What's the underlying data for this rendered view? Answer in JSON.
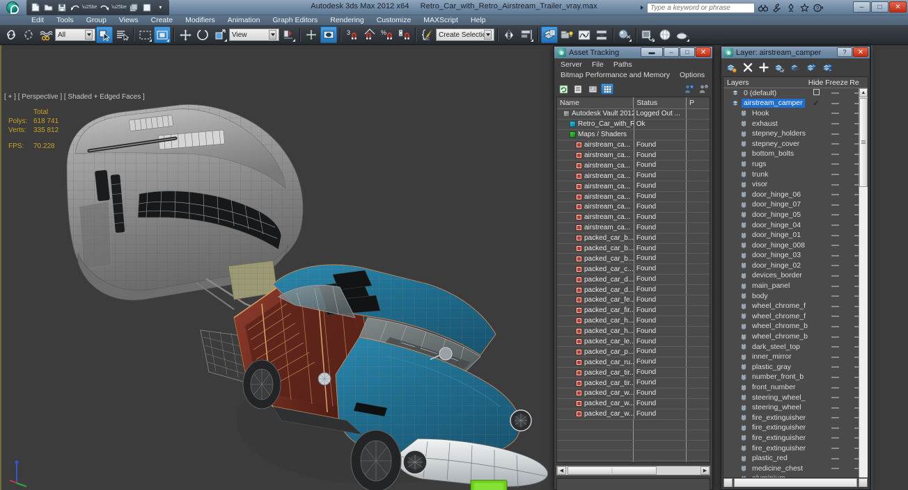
{
  "titlebar": {
    "app_title": "Autodesk 3ds Max  2012 x64",
    "document_title": "Retro_Car_with_Retro_Airstream_Trailer_vray.max",
    "search_placeholder": "Type a keyword or phrase",
    "quick_access": [
      {
        "name": "new-file-icon",
        "glyph": "▢"
      },
      {
        "name": "open-file-icon",
        "glyph": "▷"
      },
      {
        "name": "save-file-icon",
        "glyph": "▣"
      },
      {
        "name": "undo-icon",
        "glyph": "↶"
      },
      {
        "name": "redo-icon",
        "glyph": "↷"
      },
      {
        "name": "set-project-folder-icon",
        "glyph": "❐"
      },
      {
        "name": "render-setup-icon",
        "glyph": "■"
      },
      {
        "name": "customize-qat-icon",
        "glyph": "▾"
      }
    ],
    "title_icons": [
      {
        "name": "search-binoculars-icon",
        "glyph": "ɔɔ"
      },
      {
        "name": "wrench-icon",
        "glyph": "ᴦ"
      },
      {
        "name": "workspaces-icon",
        "glyph": "⥂"
      },
      {
        "name": "favorites-star-icon",
        "glyph": "★"
      },
      {
        "name": "help-icon",
        "glyph": "?"
      }
    ],
    "window_buttons": [
      {
        "name": "minimize-button",
        "glyph": "–"
      },
      {
        "name": "restore-button",
        "glyph": "□"
      },
      {
        "name": "close-button",
        "glyph": "✕"
      }
    ]
  },
  "menubar": {
    "items": [
      "Edit",
      "Tools",
      "Group",
      "Views",
      "Create",
      "Modifiers",
      "Animation",
      "Graph Editors",
      "Rendering",
      "Customize",
      "MAXScript",
      "Help"
    ]
  },
  "toolbar": {
    "selection_filter_value": "All",
    "reference_coordinate_value": "View",
    "named_selection_sets_value": "Create Selection Set",
    "items": [
      {
        "name": "undo-scene-operation-icon",
        "label": "Undo"
      },
      {
        "name": "redo-scene-operation-icon",
        "label": "Redo"
      },
      {
        "name": "select-and-link-icon",
        "label": "Select and Link"
      },
      {
        "name": "unlink-selection-icon",
        "label": "Unlink Selection"
      },
      {
        "name": "bind-to-space-warp-icon",
        "label": "Bind to Space Warp"
      },
      {
        "name": "select-object-icon",
        "label": "Select Object"
      },
      {
        "name": "select-by-name-icon",
        "label": "Select by Name"
      },
      {
        "name": "rectangular-selection-region-icon",
        "label": "Rectangular Selection Region"
      },
      {
        "name": "window-crossing-icon",
        "label": "Window/Crossing"
      },
      {
        "name": "select-and-move-icon",
        "label": "Select and Move"
      },
      {
        "name": "select-and-rotate-icon",
        "label": "Select and Rotate"
      },
      {
        "name": "select-and-scale-icon",
        "label": "Select and Uniform Scale"
      },
      {
        "name": "use-pivot-point-center-icon",
        "label": "Use Pivot Point Center"
      },
      {
        "name": "select-and-manipulate-icon",
        "label": "Select and Manipulate"
      },
      {
        "name": "snaps-toggle-icon",
        "label": "Snaps Toggle"
      },
      {
        "name": "angle-snap-toggle-icon",
        "label": "Angle Snap Toggle"
      },
      {
        "name": "percent-snap-toggle-icon",
        "label": "Percent Snap Toggle"
      },
      {
        "name": "spinner-snap-toggle-icon",
        "label": "Spinner Snap Toggle"
      },
      {
        "name": "edit-named-selection-sets-icon",
        "label": "Edit Named Selection Sets"
      },
      {
        "name": "mirror-icon",
        "label": "Mirror"
      },
      {
        "name": "align-icon",
        "label": "Align"
      },
      {
        "name": "layer-manager-icon",
        "label": "Layer Manager"
      },
      {
        "name": "graphite-modeling-tools-icon",
        "label": "Graphite Modeling Tools"
      },
      {
        "name": "curve-editor-icon",
        "label": "Curve Editor"
      },
      {
        "name": "schematic-view-icon",
        "label": "Schematic View"
      },
      {
        "name": "material-editor-icon",
        "label": "Material Editor"
      },
      {
        "name": "render-setup-icon",
        "label": "Render Setup"
      },
      {
        "name": "rendered-frame-window-icon",
        "label": "Rendered Frame Window"
      },
      {
        "name": "render-production-icon",
        "label": "Render Production"
      }
    ]
  },
  "viewport": {
    "label": "[ + ] [ Perspective ] [ Shaded + Edged Faces ]",
    "stats": {
      "header": "Total",
      "polys_label": "Polys:",
      "polys_value": "618 741",
      "verts_label": "Verts:",
      "verts_value": "335 812",
      "fps_label": "FPS:",
      "fps_value": "70.228"
    },
    "colors": {
      "background": "#3c3c3c",
      "car_body": "#1f6d8f",
      "wood_trim": "#7a3328",
      "chrome": "#cfd2d4",
      "trailer": "#9a9a9a",
      "license_plate": "#6fd11a",
      "wireframe": "#c98b5a",
      "stats_text": "#c9a227"
    }
  },
  "asset_tracking": {
    "title": "Asset Tracking",
    "menus": [
      "Server",
      "File",
      "Paths",
      "Bitmap Performance and Memory",
      "Options"
    ],
    "window_buttons": [
      {
        "name": "roll-up-button",
        "glyph": "▬"
      },
      {
        "name": "minimize-button",
        "glyph": "–"
      },
      {
        "name": "maximize-button",
        "glyph": "□"
      },
      {
        "name": "close-button",
        "glyph": "✕"
      }
    ],
    "toolbar_icons": [
      {
        "name": "refresh-icon",
        "glyph": "↻",
        "active": false
      },
      {
        "name": "list-view-icon",
        "glyph": "≡",
        "active": false
      },
      {
        "name": "detail-view-icon",
        "glyph": "▦",
        "active": false
      },
      {
        "name": "grid-view-icon",
        "glyph": "▦",
        "active": true
      },
      {
        "name": "check-in-icon",
        "glyph": "⚑",
        "active": false
      },
      {
        "name": "check-out-icon",
        "glyph": "⚐",
        "active": false
      }
    ],
    "columns": [
      "Name",
      "Status",
      "P"
    ],
    "rows": [
      {
        "icon": "vault-icon",
        "indent": 1,
        "name": "Autodesk Vault 2012",
        "status": "Logged Out ..."
      },
      {
        "icon": "scene-icon",
        "indent": 2,
        "name": "Retro_Car_with_Retr...",
        "status": "Ok"
      },
      {
        "icon": "maps-icon",
        "indent": 2,
        "name": "Maps / Shaders",
        "status": ""
      },
      {
        "icon": "bitmap-icon",
        "indent": 3,
        "name": "airstream_ca...",
        "status": "Found"
      },
      {
        "icon": "bitmap-icon",
        "indent": 3,
        "name": "airstream_ca...",
        "status": "Found"
      },
      {
        "icon": "bitmap-icon",
        "indent": 3,
        "name": "airstream_ca...",
        "status": "Found"
      },
      {
        "icon": "bitmap-icon",
        "indent": 3,
        "name": "airstream_ca...",
        "status": "Found"
      },
      {
        "icon": "bitmap-icon",
        "indent": 3,
        "name": "airstream_ca...",
        "status": "Found"
      },
      {
        "icon": "bitmap-icon",
        "indent": 3,
        "name": "airstream_ca...",
        "status": "Found"
      },
      {
        "icon": "bitmap-icon",
        "indent": 3,
        "name": "airstream_ca...",
        "status": "Found"
      },
      {
        "icon": "bitmap-icon",
        "indent": 3,
        "name": "airstream_ca...",
        "status": "Found"
      },
      {
        "icon": "bitmap-icon",
        "indent": 3,
        "name": "airstream_ca...",
        "status": "Found"
      },
      {
        "icon": "bitmap-icon",
        "indent": 3,
        "name": "packed_car_b...",
        "status": "Found"
      },
      {
        "icon": "bitmap-icon",
        "indent": 3,
        "name": "packed_car_b...",
        "status": "Found"
      },
      {
        "icon": "bitmap-icon",
        "indent": 3,
        "name": "packed_car_b...",
        "status": "Found"
      },
      {
        "icon": "bitmap-icon",
        "indent": 3,
        "name": "packed_car_c...",
        "status": "Found"
      },
      {
        "icon": "bitmap-icon",
        "indent": 3,
        "name": "packed_car_d...",
        "status": "Found"
      },
      {
        "icon": "bitmap-icon",
        "indent": 3,
        "name": "packed_car_d...",
        "status": "Found"
      },
      {
        "icon": "bitmap-icon",
        "indent": 3,
        "name": "packed_car_fe...",
        "status": "Found"
      },
      {
        "icon": "bitmap-icon",
        "indent": 3,
        "name": "packed_car_fir...",
        "status": "Found"
      },
      {
        "icon": "bitmap-icon",
        "indent": 3,
        "name": "packed_car_h...",
        "status": "Found"
      },
      {
        "icon": "bitmap-icon",
        "indent": 3,
        "name": "packed_car_h...",
        "status": "Found"
      },
      {
        "icon": "bitmap-icon",
        "indent": 3,
        "name": "packed_car_le...",
        "status": "Found"
      },
      {
        "icon": "bitmap-icon",
        "indent": 3,
        "name": "packed_car_p...",
        "status": "Found"
      },
      {
        "icon": "bitmap-icon",
        "indent": 3,
        "name": "packed_car_ru...",
        "status": "Found"
      },
      {
        "icon": "bitmap-icon",
        "indent": 3,
        "name": "packed_car_tir...",
        "status": "Found"
      },
      {
        "icon": "bitmap-icon",
        "indent": 3,
        "name": "packed_car_tir...",
        "status": "Found"
      },
      {
        "icon": "bitmap-icon",
        "indent": 3,
        "name": "packed_car_w...",
        "status": "Found"
      },
      {
        "icon": "bitmap-icon",
        "indent": 3,
        "name": "packed_car_w...",
        "status": "Found"
      },
      {
        "icon": "bitmap-icon",
        "indent": 3,
        "name": "packed_car_w...",
        "status": "Found"
      },
      {
        "icon": "",
        "indent": 0,
        "name": "",
        "status": ""
      },
      {
        "icon": "",
        "indent": 0,
        "name": "",
        "status": ""
      },
      {
        "icon": "",
        "indent": 0,
        "name": "",
        "status": ""
      },
      {
        "icon": "",
        "indent": 0,
        "name": "",
        "status": ""
      },
      {
        "icon": "",
        "indent": 0,
        "name": "",
        "status": ""
      },
      {
        "icon": "",
        "indent": 0,
        "name": "",
        "status": ""
      }
    ]
  },
  "layer_manager": {
    "title": "Layer: airstream_camper",
    "window_buttons": [
      {
        "name": "help-button",
        "glyph": "?"
      },
      {
        "name": "close-button",
        "glyph": "✕"
      }
    ],
    "toolbar_icons": [
      {
        "name": "create-new-layer-icon",
        "glyph": "⬚"
      },
      {
        "name": "delete-highlighted-empty-layers-icon",
        "glyph": "✕"
      },
      {
        "name": "add-selected-objects-to-layer-icon",
        "glyph": "＋"
      },
      {
        "name": "select-objects-in-highlighted-layers-icon",
        "glyph": "▣"
      },
      {
        "name": "highlight-selected-objects-layers-icon",
        "glyph": "▤"
      },
      {
        "name": "hide-unhide-layers-icon",
        "glyph": "▥"
      },
      {
        "name": "freeze-unfreeze-layers-icon",
        "glyph": "▧"
      }
    ],
    "columns": [
      "Layers",
      "Hide",
      "Freeze",
      "Re"
    ],
    "rows": [
      {
        "name": "0 (default)",
        "indent": 1,
        "type": "layer",
        "selected": false,
        "hide_control": "checkbox"
      },
      {
        "name": "airstream_camper",
        "indent": 1,
        "type": "layer",
        "selected": true,
        "hide_control": "check"
      },
      {
        "name": "Hook",
        "indent": 2,
        "type": "object",
        "selected": false,
        "hide_control": "none"
      },
      {
        "name": "exhaust",
        "indent": 2,
        "type": "object",
        "selected": false,
        "hide_control": "none"
      },
      {
        "name": "stepney_holders",
        "indent": 2,
        "type": "object",
        "selected": false,
        "hide_control": "none"
      },
      {
        "name": "stepney_cover",
        "indent": 2,
        "type": "object",
        "selected": false,
        "hide_control": "none"
      },
      {
        "name": "bottom_bolts",
        "indent": 2,
        "type": "object",
        "selected": false,
        "hide_control": "none"
      },
      {
        "name": "rugs",
        "indent": 2,
        "type": "object",
        "selected": false,
        "hide_control": "none"
      },
      {
        "name": "trunk",
        "indent": 2,
        "type": "object",
        "selected": false,
        "hide_control": "none"
      },
      {
        "name": "visor",
        "indent": 2,
        "type": "object",
        "selected": false,
        "hide_control": "none"
      },
      {
        "name": "door_hinge_06",
        "indent": 2,
        "type": "object",
        "selected": false,
        "hide_control": "none"
      },
      {
        "name": "door_hinge_07",
        "indent": 2,
        "type": "object",
        "selected": false,
        "hide_control": "none"
      },
      {
        "name": "door_hinge_05",
        "indent": 2,
        "type": "object",
        "selected": false,
        "hide_control": "none"
      },
      {
        "name": "door_hinge_04",
        "indent": 2,
        "type": "object",
        "selected": false,
        "hide_control": "none"
      },
      {
        "name": "door_hinge_01",
        "indent": 2,
        "type": "object",
        "selected": false,
        "hide_control": "none"
      },
      {
        "name": "door_hinge_008",
        "indent": 2,
        "type": "object",
        "selected": false,
        "hide_control": "none"
      },
      {
        "name": "door_hinge_03",
        "indent": 2,
        "type": "object",
        "selected": false,
        "hide_control": "none"
      },
      {
        "name": "door_hinge_02",
        "indent": 2,
        "type": "object",
        "selected": false,
        "hide_control": "none"
      },
      {
        "name": "devices_border",
        "indent": 2,
        "type": "object",
        "selected": false,
        "hide_control": "none"
      },
      {
        "name": "main_panel",
        "indent": 2,
        "type": "object",
        "selected": false,
        "hide_control": "none"
      },
      {
        "name": "body",
        "indent": 2,
        "type": "object",
        "selected": false,
        "hide_control": "none"
      },
      {
        "name": "wheel_chrome_f",
        "indent": 2,
        "type": "object",
        "selected": false,
        "hide_control": "none"
      },
      {
        "name": "wheel_chrome_f",
        "indent": 2,
        "type": "object",
        "selected": false,
        "hide_control": "none"
      },
      {
        "name": "wheel_chrome_b",
        "indent": 2,
        "type": "object",
        "selected": false,
        "hide_control": "none"
      },
      {
        "name": "wheel_chrome_b",
        "indent": 2,
        "type": "object",
        "selected": false,
        "hide_control": "none"
      },
      {
        "name": "dark_steel_top",
        "indent": 2,
        "type": "object",
        "selected": false,
        "hide_control": "none"
      },
      {
        "name": "inner_mirror",
        "indent": 2,
        "type": "object",
        "selected": false,
        "hide_control": "none"
      },
      {
        "name": "plastic_gray",
        "indent": 2,
        "type": "object",
        "selected": false,
        "hide_control": "none"
      },
      {
        "name": "number_front_b",
        "indent": 2,
        "type": "object",
        "selected": false,
        "hide_control": "none"
      },
      {
        "name": "front_number",
        "indent": 2,
        "type": "object",
        "selected": false,
        "hide_control": "none"
      },
      {
        "name": "steering_wheel_",
        "indent": 2,
        "type": "object",
        "selected": false,
        "hide_control": "none"
      },
      {
        "name": "steering_wheel",
        "indent": 2,
        "type": "object",
        "selected": false,
        "hide_control": "none"
      },
      {
        "name": "fire_extinguisher",
        "indent": 2,
        "type": "object",
        "selected": false,
        "hide_control": "none"
      },
      {
        "name": "fire_extinguisher",
        "indent": 2,
        "type": "object",
        "selected": false,
        "hide_control": "none"
      },
      {
        "name": "fire_extinguisher",
        "indent": 2,
        "type": "object",
        "selected": false,
        "hide_control": "none"
      },
      {
        "name": "fire_extinguisher",
        "indent": 2,
        "type": "object",
        "selected": false,
        "hide_control": "none"
      },
      {
        "name": "plastic_red",
        "indent": 2,
        "type": "object",
        "selected": false,
        "hide_control": "none"
      },
      {
        "name": "medicine_chest",
        "indent": 2,
        "type": "object",
        "selected": false,
        "hide_control": "none"
      },
      {
        "name": "aluminium",
        "indent": 2,
        "type": "object",
        "selected": false,
        "hide_control": "none"
      }
    ]
  }
}
